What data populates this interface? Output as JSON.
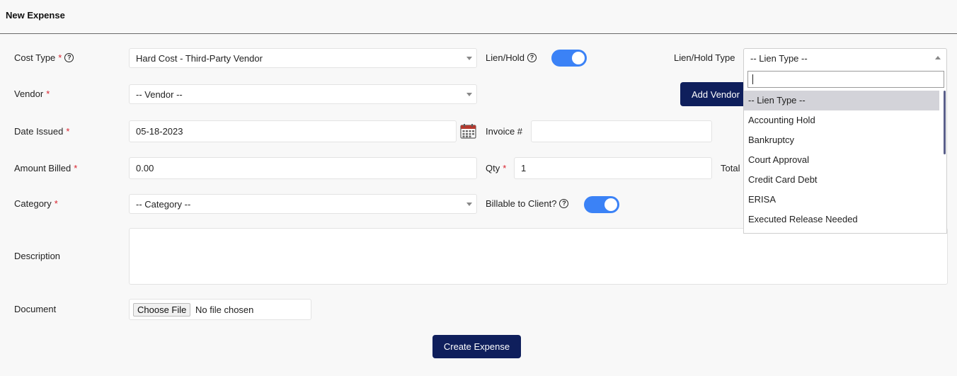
{
  "header": {
    "title": "New Expense"
  },
  "form": {
    "cost_type": {
      "label": "Cost Type",
      "value": "Hard Cost - Third-Party Vendor"
    },
    "lien_hold": {
      "label": "Lien/Hold",
      "on": true
    },
    "lien_hold_type": {
      "label": "Lien/Hold Type",
      "value": "-- Lien Type --"
    },
    "vendor": {
      "label": "Vendor",
      "value": "-- Vendor --"
    },
    "add_vendor_label": "Add Vendor",
    "date_issued": {
      "label": "Date Issued",
      "value": "05-18-2023"
    },
    "invoice": {
      "label": "Invoice #",
      "value": ""
    },
    "amount_billed": {
      "label": "Amount Billed",
      "value": "0.00"
    },
    "qty": {
      "label": "Qty",
      "value": "1"
    },
    "total": {
      "label": "Total"
    },
    "category": {
      "label": "Category",
      "value": "-- Category --"
    },
    "billable": {
      "label": "Billable to Client?",
      "on": true
    },
    "description": {
      "label": "Description",
      "value": ""
    },
    "document": {
      "label": "Document",
      "button": "Choose File",
      "status": "No file chosen"
    },
    "submit_label": "Create Expense",
    "required_mark": "*",
    "help_glyph": "?"
  },
  "lien_dropdown": {
    "search_value": "",
    "options": [
      "-- Lien Type --",
      "Accounting Hold",
      "Bankruptcy",
      "Court Approval",
      "Credit Card Debt",
      "ERISA",
      "Executed Release Needed"
    ],
    "selected_index": 0
  },
  "colors": {
    "primary_button": "#0f1f5c",
    "toggle_on": "#3b82f6",
    "required": "#d9232e",
    "selected_option": "#d3d3d9"
  }
}
